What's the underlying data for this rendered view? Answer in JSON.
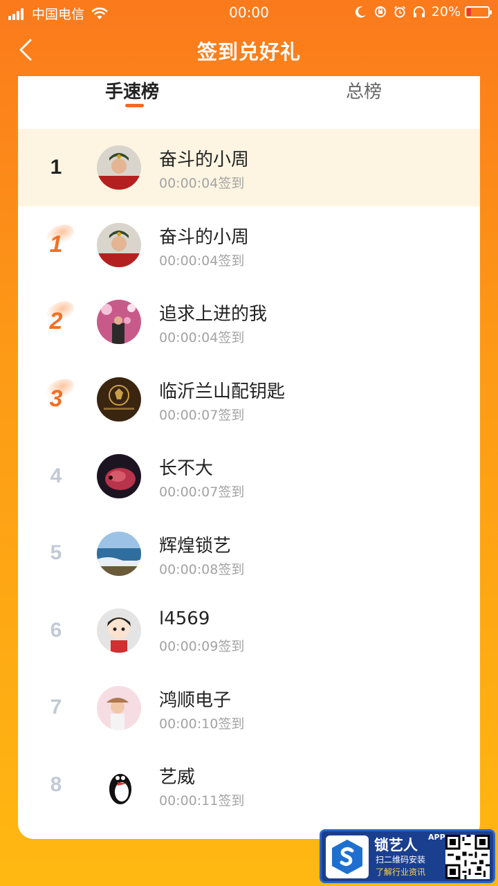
{
  "status_bar": {
    "carrier": "中国电信",
    "time": "00:00",
    "battery": "20%",
    "battery_level": 0.2
  },
  "nav": {
    "title": "签到兑好礼"
  },
  "tabs": [
    {
      "label": "手速榜",
      "active": true
    },
    {
      "label": "总榜",
      "active": false
    }
  ],
  "my_rank": {
    "rank": "1",
    "name": "奋斗的小周",
    "time": "00:00:04签到"
  },
  "ranking": [
    {
      "rank": "1",
      "name": "奋斗的小周",
      "time": "00:00:04签到"
    },
    {
      "rank": "2",
      "name": "追求上进的我",
      "time": "00:00:04签到"
    },
    {
      "rank": "3",
      "name": "临沂兰山配钥匙",
      "time": "00:00:07签到"
    },
    {
      "rank": "4",
      "name": "长不大",
      "time": "00:00:07签到"
    },
    {
      "rank": "5",
      "name": "辉煌锁艺",
      "time": "00:00:08签到"
    },
    {
      "rank": "6",
      "name": "l4569",
      "time": "00:00:09签到"
    },
    {
      "rank": "7",
      "name": "鸿顺电子",
      "time": "00:00:10签到"
    },
    {
      "rank": "8",
      "name": "艺威",
      "time": "00:00:11签到"
    }
  ],
  "ad": {
    "brand": "锁艺人",
    "app_tag": "APP",
    "line1": "扫二维码安装",
    "line2": "了解行业资讯"
  },
  "colors": {
    "header_orange": "#fb7a1c",
    "accent": "#f2682a",
    "highlight_row": "#fdf5e1"
  }
}
